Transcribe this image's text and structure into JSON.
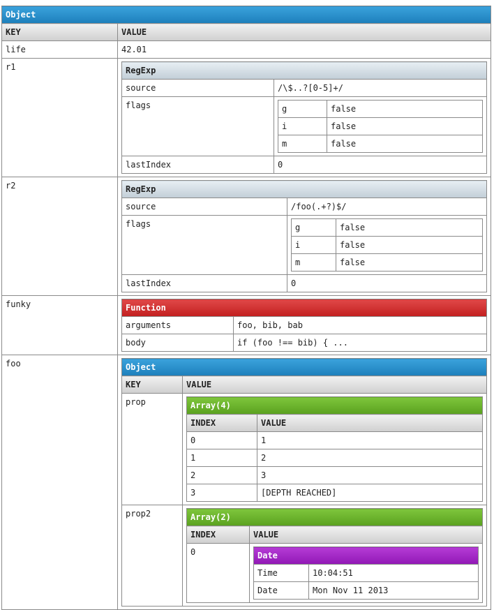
{
  "root": {
    "type": "Object",
    "header_key": "KEY",
    "header_value": "VALUE",
    "life": {
      "key": "life",
      "value": "42.01"
    },
    "r1": {
      "key": "r1",
      "type": "RegExp",
      "source_key": "source",
      "source": "/\\$..?[0-5]+/",
      "flags_key": "flags",
      "flags": [
        {
          "k": "g",
          "v": "false"
        },
        {
          "k": "i",
          "v": "false"
        },
        {
          "k": "m",
          "v": "false"
        }
      ],
      "lastIndex_key": "lastIndex",
      "lastIndex": "0"
    },
    "r2": {
      "key": "r2",
      "type": "RegExp",
      "source_key": "source",
      "source": "/foo(.+?)$/",
      "flags_key": "flags",
      "flags": [
        {
          "k": "g",
          "v": "false"
        },
        {
          "k": "i",
          "v": "false"
        },
        {
          "k": "m",
          "v": "false"
        }
      ],
      "lastIndex_key": "lastIndex",
      "lastIndex": "0"
    },
    "funky": {
      "key": "funky",
      "type": "Function",
      "arguments_key": "arguments",
      "arguments": "foo, bib, bab",
      "body_key": "body",
      "body": "if (foo !== bib) { ..."
    },
    "foo": {
      "key": "foo",
      "type": "Object",
      "header_key": "KEY",
      "header_value": "VALUE",
      "prop": {
        "key": "prop",
        "type": "Array(4)",
        "header_index": "INDEX",
        "header_value": "VALUE",
        "items": [
          {
            "i": "0",
            "v": "1"
          },
          {
            "i": "1",
            "v": "2"
          },
          {
            "i": "2",
            "v": "3"
          },
          {
            "i": "3",
            "v": "[DEPTH REACHED]"
          }
        ]
      },
      "prop2": {
        "key": "prop2",
        "type": "Array(2)",
        "header_index": "INDEX",
        "header_value": "VALUE",
        "item0": {
          "i": "0",
          "type": "Date",
          "time_key": "Time",
          "time": "10:04:51",
          "date_key": "Date",
          "date": "Mon Nov 11 2013"
        }
      }
    }
  },
  "colors": {
    "object": "#1d7fbb",
    "regexp": "#c2ced7",
    "function": "#c21f1f",
    "array": "#5aa11f",
    "date": "#9118b5"
  }
}
